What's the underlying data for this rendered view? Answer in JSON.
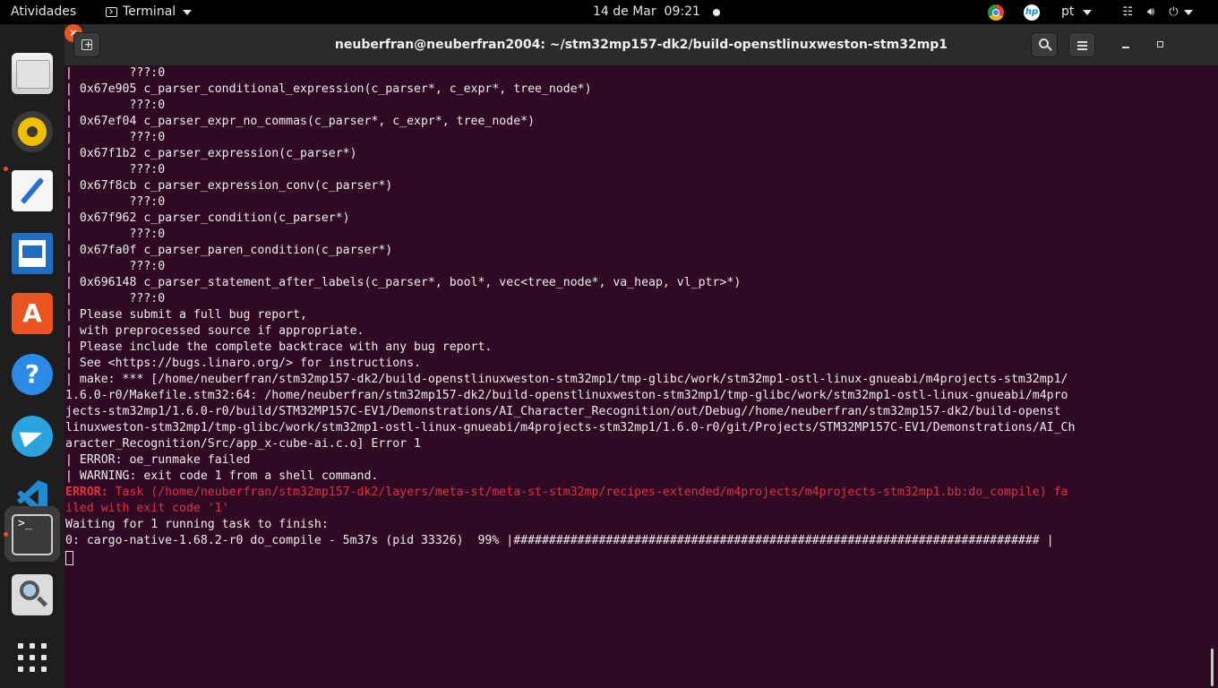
{
  "topbar": {
    "activities": "Atividades",
    "app_menu_label": "Terminal",
    "date": "14 de Mar",
    "time": "09:21",
    "language": "pt",
    "icons": [
      "chrome-icon",
      "hp-icon",
      "network-icon",
      "volume-icon",
      "power-icon"
    ]
  },
  "dock": {
    "items": [
      "files",
      "rhythmbox",
      "text-editor",
      "libreoffice-writer",
      "ubuntu-software",
      "help",
      "telegram",
      "vscode",
      "terminal",
      "image-viewer",
      "show-applications"
    ],
    "software_glyph": "A",
    "help_glyph": "?",
    "terminal_glyph": ">_",
    "accent_color": "#e95420"
  },
  "window": {
    "title": "neuberfran@neuberfran2004: ~/stm32mp157-dk2/build-openstlinuxweston-stm32mp1",
    "close_glyph": "✕"
  },
  "terminal": {
    "background": "#300a24",
    "error_color": "#e0333f",
    "lines": [
      {
        "text": "|        ???:0",
        "style": "normal"
      },
      {
        "text": "| 0x67e905 c_parser_conditional_expression(c_parser*, c_expr*, tree_node*)",
        "style": "normal"
      },
      {
        "text": "|        ???:0",
        "style": "normal"
      },
      {
        "text": "| 0x67ef04 c_parser_expr_no_commas(c_parser*, c_expr*, tree_node*)",
        "style": "normal"
      },
      {
        "text": "|        ???:0",
        "style": "normal"
      },
      {
        "text": "| 0x67f1b2 c_parser_expression(c_parser*)",
        "style": "normal"
      },
      {
        "text": "|        ???:0",
        "style": "normal"
      },
      {
        "text": "| 0x67f8cb c_parser_expression_conv(c_parser*)",
        "style": "normal"
      },
      {
        "text": "|        ???:0",
        "style": "normal"
      },
      {
        "text": "| 0x67f962 c_parser_condition(c_parser*)",
        "style": "normal"
      },
      {
        "text": "|        ???:0",
        "style": "normal"
      },
      {
        "text": "| 0x67fa0f c_parser_paren_condition(c_parser*)",
        "style": "normal"
      },
      {
        "text": "|        ???:0",
        "style": "normal"
      },
      {
        "text": "| 0x696148 c_parser_statement_after_labels(c_parser*, bool*, vec<tree_node*, va_heap, vl_ptr>*)",
        "style": "normal"
      },
      {
        "text": "|        ???:0",
        "style": "normal"
      },
      {
        "text": "| Please submit a full bug report,",
        "style": "normal"
      },
      {
        "text": "| with preprocessed source if appropriate.",
        "style": "normal"
      },
      {
        "text": "| Please include the complete backtrace with any bug report.",
        "style": "normal"
      },
      {
        "text": "| See <https://bugs.linaro.org/> for instructions.",
        "style": "normal"
      },
      {
        "text": "| make: *** [/home/neuberfran/stm32mp157-dk2/build-openstlinuxweston-stm32mp1/tmp-glibc/work/stm32mp1-ostl-linux-gnueabi/m4projects-stm32mp1/",
        "style": "normal"
      },
      {
        "text": "1.6.0-r0/Makefile.stm32:64: /home/neuberfran/stm32mp157-dk2/build-openstlinuxweston-stm32mp1/tmp-glibc/work/stm32mp1-ostl-linux-gnueabi/m4pro",
        "style": "normal"
      },
      {
        "text": "jects-stm32mp1/1.6.0-r0/build/STM32MP157C-EV1/Demonstrations/AI_Character_Recognition/out/Debug//home/neuberfran/stm32mp157-dk2/build-openst",
        "style": "normal"
      },
      {
        "text": "linuxweston-stm32mp1/tmp-glibc/work/stm32mp1-ostl-linux-gnueabi/m4projects-stm32mp1/1.6.0-r0/git/Projects/STM32MP157C-EV1/Demonstrations/AI_Ch",
        "style": "normal"
      },
      {
        "text": "aracter_Recognition/Src/app_x-cube-ai.c.o] Error 1",
        "style": "normal"
      },
      {
        "text": "| ERROR: oe_runmake failed",
        "style": "normal"
      },
      {
        "text": "| WARNING: exit code 1 from a shell command.",
        "style": "normal"
      },
      {
        "prefix": "ERROR:",
        "text": " Task (/home/neuberfran/stm32mp157-dk2/layers/meta-st/meta-st-stm32mp/recipes-extended/m4projects/m4projects-stm32mp1.bb:do_compile) fa",
        "style": "error"
      },
      {
        "text": "iled with exit code '1'",
        "style": "error"
      },
      {
        "text": "Waiting for 1 running task to finish:",
        "style": "normal"
      },
      {
        "text": "0: cargo-native-1.68.2-r0 do_compile - 5m37s (pid 33326)  99% |########################################################################## |",
        "style": "normal"
      }
    ]
  }
}
